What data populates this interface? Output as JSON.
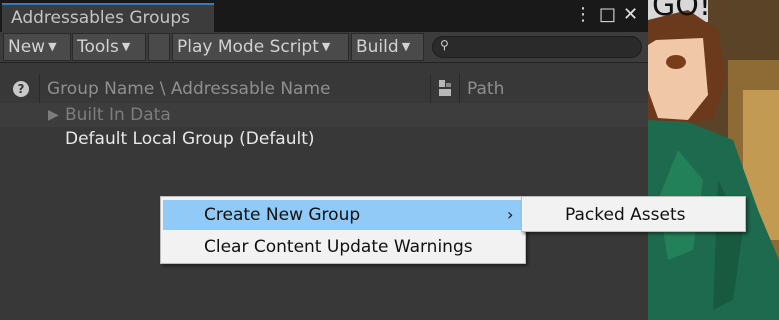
{
  "window": {
    "tab_title": "Addressables Groups",
    "controls": {
      "more_icon": "⋮",
      "maximize_icon": "□",
      "close_icon": "✕"
    }
  },
  "toolbar": {
    "new_label": "New",
    "tools_label": "Tools",
    "play_mode_label": "Play Mode Script",
    "build_label": "Build",
    "caret": "▼",
    "search_placeholder": ""
  },
  "columns": {
    "name_header": "Group Name \\ Addressable Name",
    "path_header": "Path"
  },
  "tree": {
    "built_in": {
      "arrow": "▶",
      "label": "Built In Data"
    },
    "default_group": {
      "label": "Default Local Group (Default)"
    }
  },
  "context_menu": {
    "items": [
      {
        "label": "Create New Group",
        "arrow": "›",
        "highlighted": true
      },
      {
        "label": "Clear Content Update Warnings"
      }
    ],
    "submenu": {
      "items": [
        {
          "label": "Packed Assets"
        }
      ]
    }
  },
  "scene": {
    "overlay_text": "GO!"
  },
  "colors": {
    "panel_bg": "#383838",
    "tab_accent": "#3a79bb",
    "menu_bg": "#f2f2f2",
    "menu_highlight": "#91c9f7"
  }
}
